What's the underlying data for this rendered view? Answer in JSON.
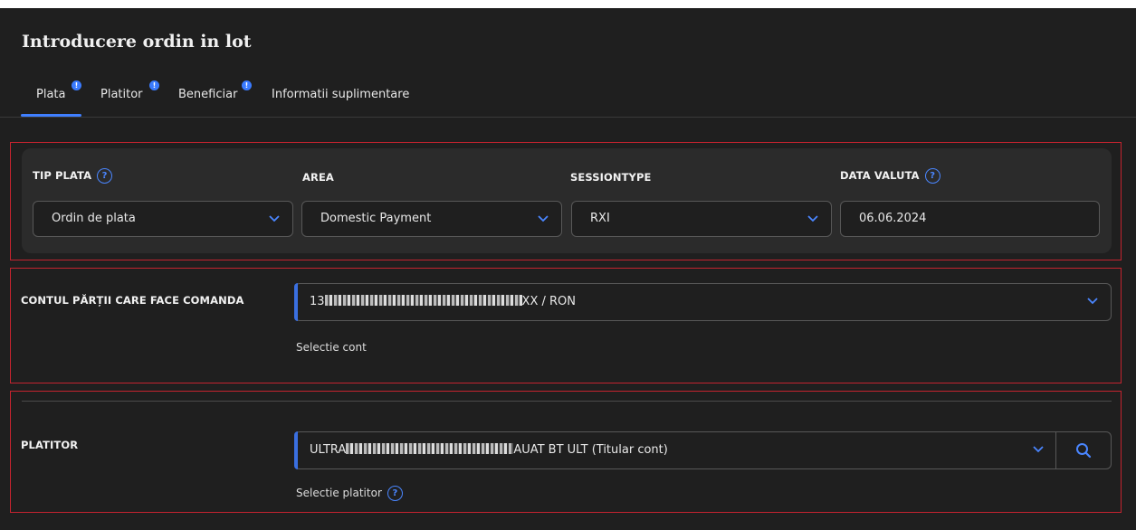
{
  "page": {
    "title": "Introducere ordin in lot"
  },
  "tabs": [
    {
      "label": "Plata",
      "badge": "!",
      "active": true
    },
    {
      "label": "Platitor",
      "badge": "!"
    },
    {
      "label": "Beneficiar",
      "badge": "!"
    },
    {
      "label": "Informatii suplimentare"
    }
  ],
  "payment": {
    "tip_plata": {
      "label": "TIP PLATA",
      "value": "Ordin de plata"
    },
    "area": {
      "label": "AREA",
      "value": "Domestic Payment"
    },
    "session_type": {
      "label": "SESSIONTYPE",
      "value": "RXI"
    },
    "data_valuta": {
      "label": "DATA VALUTA",
      "value": "06.06.2024"
    },
    "help_glyph": "?"
  },
  "account": {
    "label": "CONTUL PĂRȚII CARE FACE COMANDA",
    "value_prefix": "13",
    "value_suffix": "XX / RON",
    "hint": "Selectie cont"
  },
  "payer": {
    "label": "PLATITOR",
    "value_prefix": "ULTRA",
    "value_suffix": "AUAT BT ULT (Titular cont)",
    "hint": "Selectie platitor"
  },
  "colors": {
    "accent": "#3a7bff",
    "highlight_border": "#c4232f",
    "background": "#1f1f1f"
  }
}
